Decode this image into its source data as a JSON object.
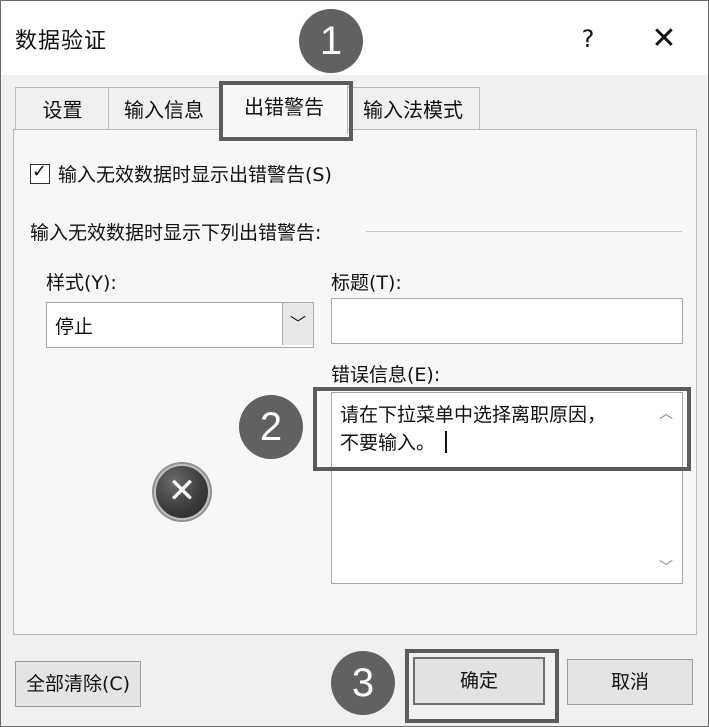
{
  "window": {
    "title": "数据验证",
    "help": "?",
    "close": "✕"
  },
  "tabs": [
    {
      "label": "设置",
      "active": false
    },
    {
      "label": "输入信息",
      "active": false
    },
    {
      "label": "出错警告",
      "active": true
    },
    {
      "label": "输入法模式",
      "active": false
    }
  ],
  "error_alert": {
    "show_checkbox_label": "输入无效数据时显示出错警告(S)",
    "show_checkbox_checked": true,
    "section_title": "输入无效数据时显示下列出错警告:",
    "style_label": "样式(Y):",
    "style_value": "停止",
    "title_label": "标题(T):",
    "title_value": "",
    "message_label": "错误信息(E):",
    "message_value": "请在下拉菜单中选择离职原因，\n不要输入。"
  },
  "buttons": {
    "clear_all": "全部清除(C)",
    "ok": "确定",
    "cancel": "取消"
  },
  "callouts": [
    "1",
    "2",
    "3"
  ],
  "colors": {
    "callout": "#616161",
    "outline": "#5b5b5b"
  }
}
